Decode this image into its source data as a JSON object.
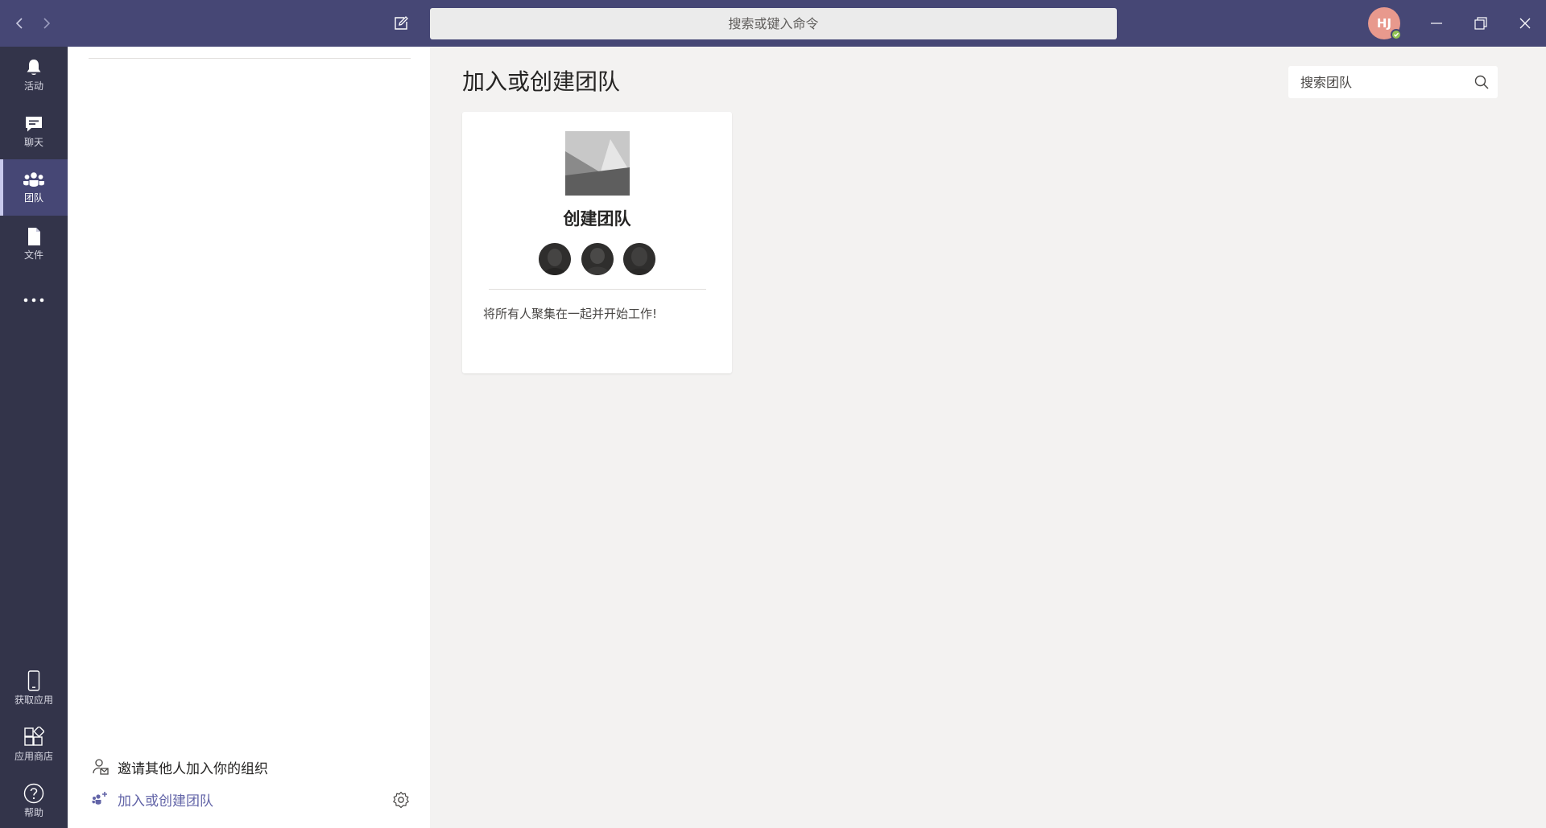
{
  "titlebar": {
    "command_search_placeholder": "搜索或键入命令",
    "avatar_initials": "HJ",
    "presence_status": "available"
  },
  "rail": {
    "items": [
      {
        "label": "活动",
        "icon": "bell-icon"
      },
      {
        "label": "聊天",
        "icon": "chat-icon"
      },
      {
        "label": "团队",
        "icon": "teams-icon",
        "active": true
      },
      {
        "label": "文件",
        "icon": "file-icon"
      },
      {
        "label": "",
        "icon": "more-icon"
      }
    ],
    "bottom_items": [
      {
        "label": "获取应用",
        "icon": "phone-icon"
      },
      {
        "label": "应用商店",
        "icon": "store-icon"
      },
      {
        "label": "帮助",
        "icon": "help-icon"
      }
    ]
  },
  "list_panel": {
    "invite_label": "邀请其他人加入你的组织",
    "join_create_label": "加入或创建团队"
  },
  "main": {
    "page_title": "加入或创建团队",
    "team_search_placeholder": "搜索团队",
    "create_card": {
      "title": "创建团队",
      "description": "将所有人聚集在一起并开始工作!"
    }
  },
  "colors": {
    "titlebar": "#464775",
    "rail": "#33344a",
    "accent": "#6264a7",
    "avatar": "#e8998d",
    "presence": "#92c353"
  }
}
